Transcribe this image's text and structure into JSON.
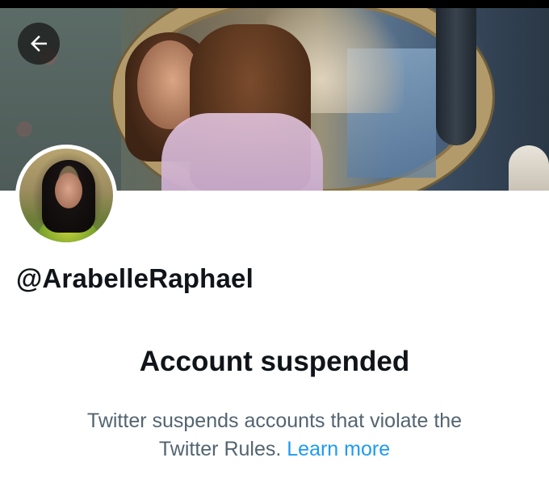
{
  "profile": {
    "handle": "@ArabelleRaphael",
    "back_icon": "arrow-left-icon"
  },
  "suspension": {
    "title": "Account suspended",
    "message_line1": "Twitter suspends accounts that violate the",
    "message_line2_prefix": "Twitter Rules.",
    "learn_more_label": "Learn more"
  },
  "colors": {
    "text_primary": "#0f1419",
    "text_secondary": "#536471",
    "link": "#1d9bf0"
  }
}
